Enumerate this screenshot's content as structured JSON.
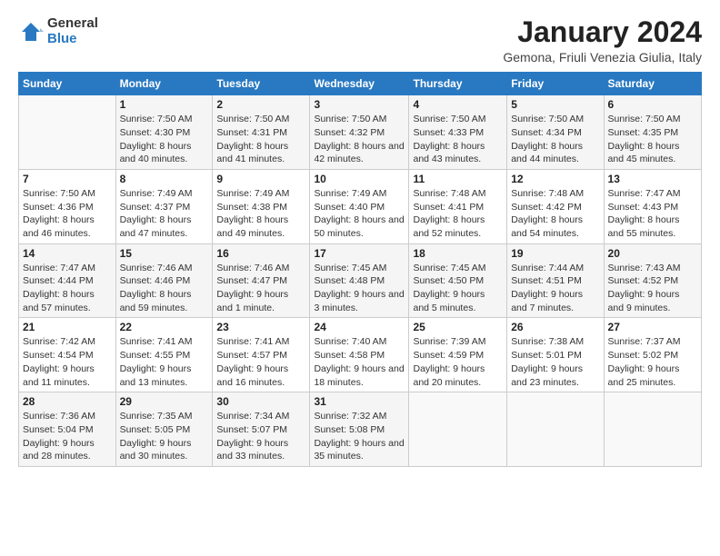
{
  "logo": {
    "general": "General",
    "blue": "Blue"
  },
  "header": {
    "title": "January 2024",
    "subtitle": "Gemona, Friuli Venezia Giulia, Italy"
  },
  "weekdays": [
    "Sunday",
    "Monday",
    "Tuesday",
    "Wednesday",
    "Thursday",
    "Friday",
    "Saturday"
  ],
  "weeks": [
    [
      {
        "day": "",
        "sunrise": "",
        "sunset": "",
        "daylight": ""
      },
      {
        "day": "1",
        "sunrise": "Sunrise: 7:50 AM",
        "sunset": "Sunset: 4:30 PM",
        "daylight": "Daylight: 8 hours and 40 minutes."
      },
      {
        "day": "2",
        "sunrise": "Sunrise: 7:50 AM",
        "sunset": "Sunset: 4:31 PM",
        "daylight": "Daylight: 8 hours and 41 minutes."
      },
      {
        "day": "3",
        "sunrise": "Sunrise: 7:50 AM",
        "sunset": "Sunset: 4:32 PM",
        "daylight": "Daylight: 8 hours and 42 minutes."
      },
      {
        "day": "4",
        "sunrise": "Sunrise: 7:50 AM",
        "sunset": "Sunset: 4:33 PM",
        "daylight": "Daylight: 8 hours and 43 minutes."
      },
      {
        "day": "5",
        "sunrise": "Sunrise: 7:50 AM",
        "sunset": "Sunset: 4:34 PM",
        "daylight": "Daylight: 8 hours and 44 minutes."
      },
      {
        "day": "6",
        "sunrise": "Sunrise: 7:50 AM",
        "sunset": "Sunset: 4:35 PM",
        "daylight": "Daylight: 8 hours and 45 minutes."
      }
    ],
    [
      {
        "day": "7",
        "sunrise": "Sunrise: 7:50 AM",
        "sunset": "Sunset: 4:36 PM",
        "daylight": "Daylight: 8 hours and 46 minutes."
      },
      {
        "day": "8",
        "sunrise": "Sunrise: 7:49 AM",
        "sunset": "Sunset: 4:37 PM",
        "daylight": "Daylight: 8 hours and 47 minutes."
      },
      {
        "day": "9",
        "sunrise": "Sunrise: 7:49 AM",
        "sunset": "Sunset: 4:38 PM",
        "daylight": "Daylight: 8 hours and 49 minutes."
      },
      {
        "day": "10",
        "sunrise": "Sunrise: 7:49 AM",
        "sunset": "Sunset: 4:40 PM",
        "daylight": "Daylight: 8 hours and 50 minutes."
      },
      {
        "day": "11",
        "sunrise": "Sunrise: 7:48 AM",
        "sunset": "Sunset: 4:41 PM",
        "daylight": "Daylight: 8 hours and 52 minutes."
      },
      {
        "day": "12",
        "sunrise": "Sunrise: 7:48 AM",
        "sunset": "Sunset: 4:42 PM",
        "daylight": "Daylight: 8 hours and 54 minutes."
      },
      {
        "day": "13",
        "sunrise": "Sunrise: 7:47 AM",
        "sunset": "Sunset: 4:43 PM",
        "daylight": "Daylight: 8 hours and 55 minutes."
      }
    ],
    [
      {
        "day": "14",
        "sunrise": "Sunrise: 7:47 AM",
        "sunset": "Sunset: 4:44 PM",
        "daylight": "Daylight: 8 hours and 57 minutes."
      },
      {
        "day": "15",
        "sunrise": "Sunrise: 7:46 AM",
        "sunset": "Sunset: 4:46 PM",
        "daylight": "Daylight: 8 hours and 59 minutes."
      },
      {
        "day": "16",
        "sunrise": "Sunrise: 7:46 AM",
        "sunset": "Sunset: 4:47 PM",
        "daylight": "Daylight: 9 hours and 1 minute."
      },
      {
        "day": "17",
        "sunrise": "Sunrise: 7:45 AM",
        "sunset": "Sunset: 4:48 PM",
        "daylight": "Daylight: 9 hours and 3 minutes."
      },
      {
        "day": "18",
        "sunrise": "Sunrise: 7:45 AM",
        "sunset": "Sunset: 4:50 PM",
        "daylight": "Daylight: 9 hours and 5 minutes."
      },
      {
        "day": "19",
        "sunrise": "Sunrise: 7:44 AM",
        "sunset": "Sunset: 4:51 PM",
        "daylight": "Daylight: 9 hours and 7 minutes."
      },
      {
        "day": "20",
        "sunrise": "Sunrise: 7:43 AM",
        "sunset": "Sunset: 4:52 PM",
        "daylight": "Daylight: 9 hours and 9 minutes."
      }
    ],
    [
      {
        "day": "21",
        "sunrise": "Sunrise: 7:42 AM",
        "sunset": "Sunset: 4:54 PM",
        "daylight": "Daylight: 9 hours and 11 minutes."
      },
      {
        "day": "22",
        "sunrise": "Sunrise: 7:41 AM",
        "sunset": "Sunset: 4:55 PM",
        "daylight": "Daylight: 9 hours and 13 minutes."
      },
      {
        "day": "23",
        "sunrise": "Sunrise: 7:41 AM",
        "sunset": "Sunset: 4:57 PM",
        "daylight": "Daylight: 9 hours and 16 minutes."
      },
      {
        "day": "24",
        "sunrise": "Sunrise: 7:40 AM",
        "sunset": "Sunset: 4:58 PM",
        "daylight": "Daylight: 9 hours and 18 minutes."
      },
      {
        "day": "25",
        "sunrise": "Sunrise: 7:39 AM",
        "sunset": "Sunset: 4:59 PM",
        "daylight": "Daylight: 9 hours and 20 minutes."
      },
      {
        "day": "26",
        "sunrise": "Sunrise: 7:38 AM",
        "sunset": "Sunset: 5:01 PM",
        "daylight": "Daylight: 9 hours and 23 minutes."
      },
      {
        "day": "27",
        "sunrise": "Sunrise: 7:37 AM",
        "sunset": "Sunset: 5:02 PM",
        "daylight": "Daylight: 9 hours and 25 minutes."
      }
    ],
    [
      {
        "day": "28",
        "sunrise": "Sunrise: 7:36 AM",
        "sunset": "Sunset: 5:04 PM",
        "daylight": "Daylight: 9 hours and 28 minutes."
      },
      {
        "day": "29",
        "sunrise": "Sunrise: 7:35 AM",
        "sunset": "Sunset: 5:05 PM",
        "daylight": "Daylight: 9 hours and 30 minutes."
      },
      {
        "day": "30",
        "sunrise": "Sunrise: 7:34 AM",
        "sunset": "Sunset: 5:07 PM",
        "daylight": "Daylight: 9 hours and 33 minutes."
      },
      {
        "day": "31",
        "sunrise": "Sunrise: 7:32 AM",
        "sunset": "Sunset: 5:08 PM",
        "daylight": "Daylight: 9 hours and 35 minutes."
      },
      {
        "day": "",
        "sunrise": "",
        "sunset": "",
        "daylight": ""
      },
      {
        "day": "",
        "sunrise": "",
        "sunset": "",
        "daylight": ""
      },
      {
        "day": "",
        "sunrise": "",
        "sunset": "",
        "daylight": ""
      }
    ]
  ]
}
